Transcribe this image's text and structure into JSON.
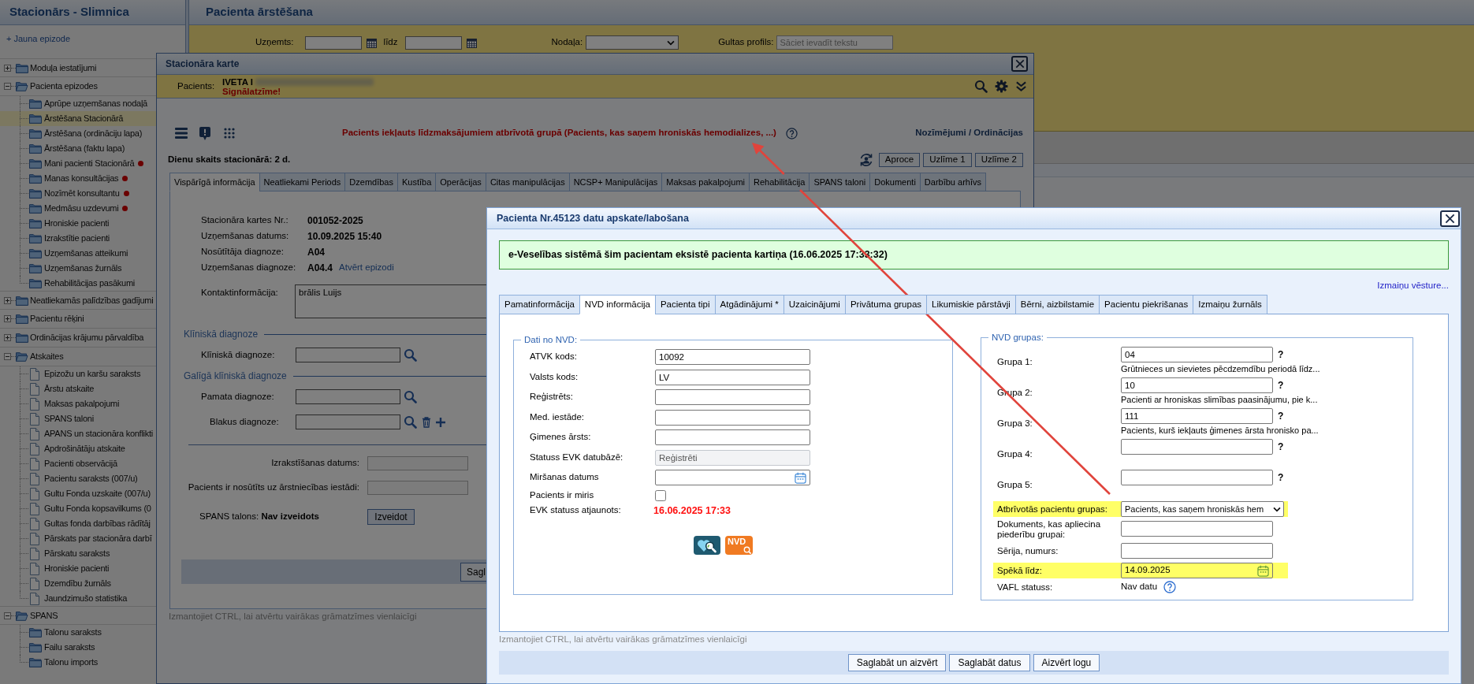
{
  "sidebar": {
    "title": "Stacionārs - Slimnica",
    "new_episode_link": "+ Jauna epizode",
    "tree": [
      {
        "label": "Moduļa iestatījumi",
        "expanded": false,
        "selected": false
      },
      {
        "label": "Pacienta epizodes",
        "expanded": true,
        "selected": false,
        "children": [
          {
            "kind": "folder",
            "label": "Aprūpe uzņemšanas nodaļā",
            "selected": false,
            "alert": false
          },
          {
            "kind": "folder",
            "label": "Ārstēšana Stacionārā",
            "selected": true,
            "alert": false
          },
          {
            "kind": "folder",
            "label": "Ārstēšana (ordināciju lapa)",
            "selected": false,
            "alert": false
          },
          {
            "kind": "folder",
            "label": "Ārstēšana (faktu lapa)",
            "selected": false,
            "alert": false
          },
          {
            "kind": "folder",
            "label": "Mani pacienti Stacionārā",
            "selected": false,
            "alert": true
          },
          {
            "kind": "folder",
            "label": "Manas konsultācijas",
            "selected": false,
            "alert": true
          },
          {
            "kind": "folder",
            "label": "Nozīmēt konsultantu",
            "selected": false,
            "alert": true
          },
          {
            "kind": "folder",
            "label": "Medmāsu uzdevumi",
            "selected": false,
            "alert": true
          },
          {
            "kind": "folder",
            "label": "Hroniskie pacienti",
            "selected": false,
            "alert": false
          },
          {
            "kind": "folder",
            "label": "Izrakstītie pacienti",
            "selected": false,
            "alert": false
          },
          {
            "kind": "folder",
            "label": "Uzņemšanas atteikumi",
            "selected": false,
            "alert": false
          },
          {
            "kind": "folder",
            "label": "Uzņemšanas žurnāls",
            "selected": false,
            "alert": false
          },
          {
            "kind": "folder",
            "label": "Rehabilitācijas pasākumi",
            "selected": false,
            "alert": false
          }
        ]
      },
      {
        "label": "Neatliekamās palīdzības gadījumi",
        "expanded": false,
        "selected": false
      },
      {
        "label": "Pacientu rēķini",
        "expanded": false,
        "selected": false
      },
      {
        "label": "Ordinācijas krājumu pārvaldība",
        "expanded": false,
        "selected": false
      },
      {
        "label": "Atskaites",
        "expanded": true,
        "selected": false,
        "children": [
          {
            "kind": "document",
            "label": "Epizožu un karšu saraksts",
            "selected": false,
            "alert": false
          },
          {
            "kind": "document",
            "label": "Ārstu atskaite",
            "selected": false,
            "alert": false
          },
          {
            "kind": "document",
            "label": "Maksas pakalpojumi",
            "selected": false,
            "alert": false
          },
          {
            "kind": "document",
            "label": "SPANS taloni",
            "selected": false,
            "alert": false
          },
          {
            "kind": "document",
            "label": "APANS un stacionāra konflikti",
            "selected": false,
            "alert": false
          },
          {
            "kind": "document",
            "label": "Apdrošinātāju atskaite",
            "selected": false,
            "alert": false
          },
          {
            "kind": "document",
            "label": "Pacienti observācijā",
            "selected": false,
            "alert": false
          },
          {
            "kind": "document",
            "label": "Pacientu saraksts (007/u)",
            "selected": false,
            "alert": false
          },
          {
            "kind": "document",
            "label": "Gultu Fonda uzskaite (007/u)",
            "selected": false,
            "alert": false
          },
          {
            "kind": "document",
            "label": "Gultu Fonda kopsavilkums (0",
            "selected": false,
            "alert": false
          },
          {
            "kind": "document",
            "label": "Gultas fonda darbības rādītāj",
            "selected": false,
            "alert": false
          },
          {
            "kind": "document",
            "label": "Pārskats par stacionāra darbī",
            "selected": false,
            "alert": false
          },
          {
            "kind": "document",
            "label": "Pārskatu saraksts",
            "selected": false,
            "alert": false
          },
          {
            "kind": "document",
            "label": "Hroniskie pacienti",
            "selected": false,
            "alert": false
          },
          {
            "kind": "document",
            "label": "Dzemdību žurnāls",
            "selected": false,
            "alert": false
          },
          {
            "kind": "document",
            "label": "Jaundzimušo statistika",
            "selected": false,
            "alert": false
          }
        ]
      },
      {
        "label": "SPANS",
        "expanded": true,
        "selected": false,
        "children": [
          {
            "kind": "folder",
            "label": "Talonu saraksts",
            "selected": false,
            "alert": false
          },
          {
            "kind": "folder",
            "label": "Failu saraksts",
            "selected": false,
            "alert": false
          },
          {
            "kind": "folder",
            "label": "Talonu imports",
            "selected": false,
            "alert": false
          }
        ]
      }
    ]
  },
  "main": {
    "title": "Pacienta ārstēšana",
    "filters": [
      {
        "kind": "date",
        "label": "Uzņemts:"
      },
      {
        "kind": "date",
        "label": "līdz"
      },
      {
        "kind": "select",
        "label": "Nodaļa:"
      },
      {
        "kind": "text",
        "label": "Gultas profils:",
        "placeholder": "Sāciet ievadīt tekstu"
      }
    ]
  },
  "inpatient_card": {
    "title": "Stacionāra karte",
    "patient_label": "Pacients:",
    "patient_name": "IVETA I",
    "signal": "Signālatzīme!",
    "notice": "Pacients iekļauts līdzmaksājumiem atbrīvotā grupā (Pacients, kas saņem hroniskās hemodializes, ...)",
    "orders_link": "Nozīmējumi / Ordinācijas",
    "days": "Dienu skaits stacionārā: 2 d.",
    "buttons": [
      "Aproce",
      "Uzlīme 1",
      "Uzlīme 2"
    ],
    "tabs": [
      {
        "label": "Vispārīgā informācija",
        "selected": true
      },
      {
        "label": "Neatliekami Periods",
        "selected": false
      },
      {
        "label": "Dzemdības",
        "selected": false
      },
      {
        "label": "Kustība",
        "selected": false
      },
      {
        "label": "Operācijas",
        "selected": false
      },
      {
        "label": "Citas manipulācijas",
        "selected": false
      },
      {
        "label": "NCSP+ Manipulācijas",
        "selected": false
      },
      {
        "label": "Maksas pakalpojumi",
        "selected": false
      },
      {
        "label": "Rehabilitācija",
        "selected": false
      },
      {
        "label": "SPANS taloni",
        "selected": false
      },
      {
        "label": "Dokumenti",
        "selected": false
      },
      {
        "label": "Darbību arhīvs",
        "selected": false
      }
    ],
    "info": [
      {
        "label": "Stacionāra kartes Nr.:",
        "value": "001052-2025"
      },
      {
        "label": "Uzņemšanas datums:",
        "value": "10.09.2025 15:40"
      },
      {
        "label": "Nosūtītāja diagnoze:",
        "value": "A04"
      },
      {
        "label": "Uzņemšanas diagnoze:",
        "value": "A04.4",
        "link": "Atvērt epizodi"
      }
    ],
    "contact": {
      "label": "Kontaktinformācija:",
      "value": "brālis Luijs"
    },
    "diagnosis_sections": [
      {
        "title": "Klīniskā diagnoze",
        "fields": [
          {
            "kind": "single",
            "label": "Klīniskā diagnoze:"
          }
        ]
      },
      {
        "title": "Galīgā klīniskā diagnoze",
        "fields": [
          {
            "kind": "single",
            "label": "Pamata diagnoze:"
          },
          {
            "kind": "multiple",
            "label": "Blakus diagnoze:"
          }
        ]
      }
    ],
    "discharge_fields": [
      {
        "label": "Izrakstīšanas datums:"
      },
      {
        "label": "Pacients ir nosūtīts uz ārstniecības iestādi:"
      }
    ],
    "spans_status": "SPANS talons: **Nav izveidots**",
    "spans_button": "Izveidot",
    "footer_buttons": [
      "Sagl"
    ],
    "hint": "Izmantojiet CTRL, lai atvērtu vairākas grāmatzīmes vienlaicīgi"
  },
  "patient_dialog": {
    "title": "Pacienta Nr.45123 datu apskate/labošana",
    "banner": "e-Veselības sistēmā šim pacientam eksistē pacienta kartiņa (16.06.2025 17:33:32)",
    "history_link": "Izmaiņu vēsture...",
    "tabs": [
      {
        "label": "Pamatinformācija",
        "selected": false
      },
      {
        "label": "NVD informācija",
        "selected": true
      },
      {
        "label": "Pacienta tipi",
        "selected": false
      },
      {
        "label": "Atgādinājumi *",
        "selected": false
      },
      {
        "label": "Uzaicinājumi",
        "selected": false
      },
      {
        "label": "Privātuma grupas",
        "selected": false
      },
      {
        "label": "Likumiskie pārstāvji",
        "selected": false
      },
      {
        "label": "Bērni, aizbilstamie",
        "selected": false
      },
      {
        "label": "Pacientu piekrišanas",
        "selected": false
      },
      {
        "label": "Izmaiņu žurnāls",
        "selected": false
      }
    ],
    "nvd_data": {
      "legend": "Dati no NVD:",
      "rows": [
        {
          "kind": "input",
          "label": "ATVK kods:",
          "value": "10092",
          "disabled": false
        },
        {
          "kind": "input",
          "label": "Valsts kods:",
          "value": "LV",
          "disabled": false
        },
        {
          "kind": "input",
          "label": "Reģistrēts:",
          "disabled": false
        },
        {
          "kind": "input",
          "label": "Med. iestāde:",
          "disabled": false
        },
        {
          "kind": "input",
          "label": "Ģimenes ārsts:",
          "disabled": false
        },
        {
          "kind": "input",
          "label": "Statuss EVK datubāzē:",
          "value": "Reģistrēti",
          "disabled": true
        },
        {
          "kind": "date",
          "label": "Miršanas datums"
        },
        {
          "kind": "checkbox",
          "label": "Pacients ir miris",
          "checked": false
        },
        {
          "kind": "timestamp",
          "label": "EVK statuss atjaunots:",
          "value": "16.06.2025 17:33"
        }
      ],
      "lookup_buttons": [
        {
          "kind": "evk"
        },
        {
          "kind": "nvd",
          "label": "NVD"
        }
      ]
    },
    "nvd_groups": {
      "legend": "NVD grupas:",
      "groups": [
        {
          "label": "Grupa 1:",
          "value": "04",
          "help": "?",
          "description": "Grūtnieces un sievietes pēcdzemdību periodā līdz..."
        },
        {
          "label": "Grupa 2:",
          "value": "10",
          "help": "?",
          "description": "Pacienti ar hroniskas slimības paasinājumu, pie k..."
        },
        {
          "label": "Grupa 3:",
          "value": "111",
          "help": "?",
          "description": "Pacients, kurš iekļauts ģimenes ārsta hronisko pa..."
        },
        {
          "label": "Grupa 4:",
          "help": "?"
        },
        {
          "label": "Grupa 5:",
          "help": "?"
        }
      ],
      "rows": [
        {
          "kind": "select",
          "label": "Atbrīvotās pacientu grupas:",
          "value": "Pacients, kas saņem hroniskās hem",
          "highlighted": true
        },
        {
          "kind": "input",
          "label": "Dokuments, kas apliecina piederību grupai:",
          "highlighted": false
        },
        {
          "kind": "input",
          "label": "Sērija, numurs:",
          "highlighted": false
        },
        {
          "kind": "date",
          "label": "Spēkā līdz:",
          "value": "14.09.2025",
          "highlighted": true
        },
        {
          "kind": "status",
          "label": "VAFL statuss:",
          "value": "Nav datu",
          "highlighted": false
        }
      ]
    },
    "hint": "Izmantojiet CTRL, lai atvērtu vairākas grāmatzīmes vienlaicīgi",
    "buttons": [
      "Saglabāt un aizvērt",
      "Saglabāt datus",
      "Aizvērt logu"
    ]
  }
}
